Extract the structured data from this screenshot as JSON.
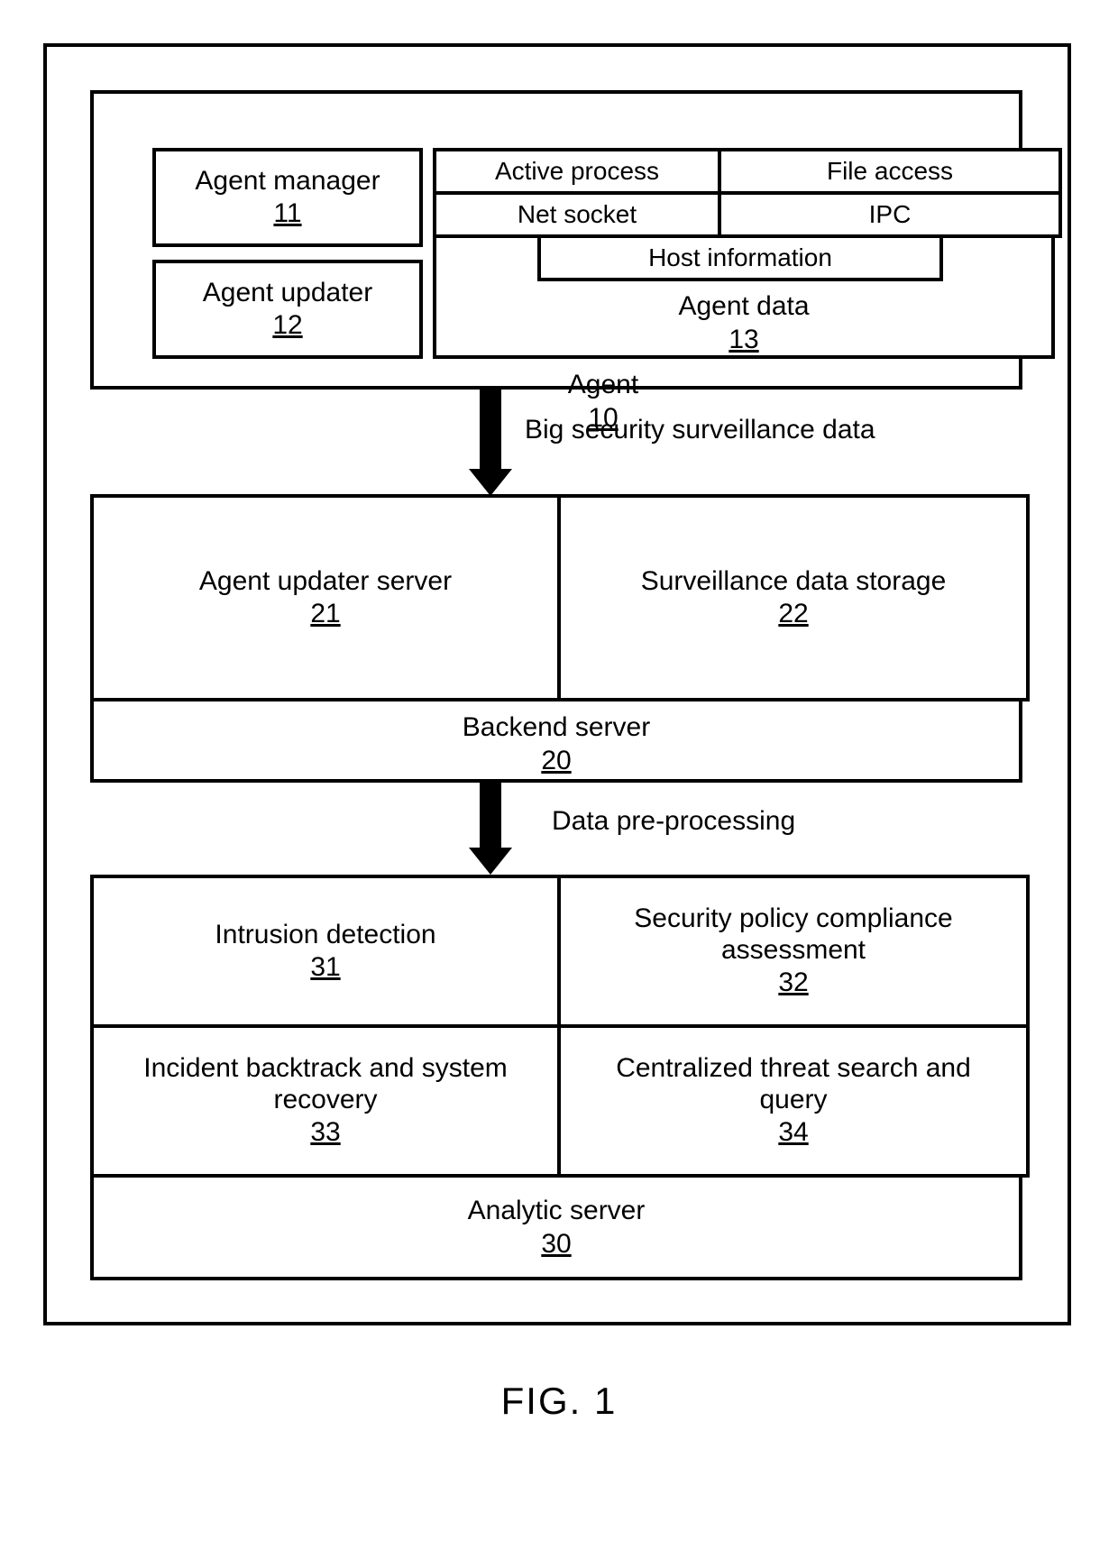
{
  "figure_caption": "FIG. 1",
  "agent": {
    "label": "Agent",
    "ref": "10",
    "manager": {
      "label": "Agent manager",
      "ref": "11"
    },
    "updater": {
      "label": "Agent updater",
      "ref": "12"
    },
    "data": {
      "label": "Agent data",
      "ref": "13",
      "tags": {
        "active_process": "Active process",
        "file_access": "File access",
        "net_socket": "Net socket",
        "ipc": "IPC",
        "host_info": "Host information"
      }
    }
  },
  "arrows": {
    "arrow1_label": "Big security surveillance data",
    "arrow2_label": "Data pre-processing"
  },
  "backend": {
    "label": "Backend server",
    "ref": "20",
    "updater_server": {
      "label": "Agent updater server",
      "ref": "21"
    },
    "data_storage": {
      "label": "Surveillance data storage",
      "ref": "22"
    }
  },
  "analytic": {
    "label": "Analytic server",
    "ref": "30",
    "intrusion_detection": {
      "label": "Intrusion detection",
      "ref": "31"
    },
    "policy_compliance": {
      "label": "Security policy compliance assessment",
      "ref": "32"
    },
    "incident_backtrack": {
      "label": "Incident backtrack and system recovery",
      "ref": "33"
    },
    "threat_search": {
      "label": "Centralized threat search and query",
      "ref": "34"
    }
  }
}
